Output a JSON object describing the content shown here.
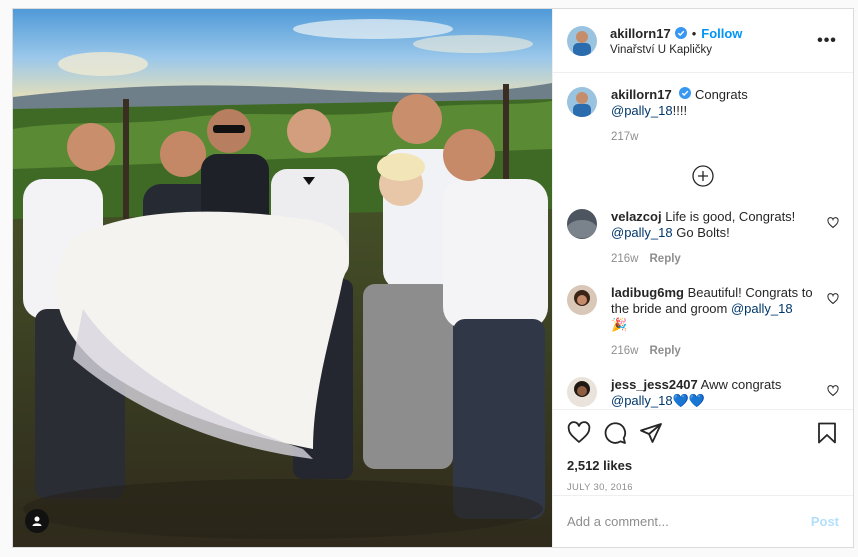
{
  "post": {
    "author": {
      "username": "akillorn17",
      "verified": true,
      "follow_label": "Follow",
      "location": "Vinařství U Kapličky",
      "more_label": "•••"
    },
    "caption": {
      "username": "akillorn17",
      "text": "Congrats ",
      "mention": "@pally_18",
      "suffix": "!!!!",
      "time": "217w"
    },
    "comments": [
      {
        "username": "velazcoj",
        "text": "Life is good, Congrats! ",
        "mention": "@pally_18",
        "suffix": " Go Bolts!",
        "time": "216w",
        "reply_label": "Reply"
      },
      {
        "username": "ladibug6mg",
        "text": "Beautiful! Congrats to the bride and groom ",
        "mention": "@pally_18",
        "suffix": "🎉",
        "time": "216w",
        "reply_label": "Reply"
      },
      {
        "username": "jess_jess2407",
        "text": "Aww congrats ",
        "mention": "@pally_18",
        "suffix": "💙💙",
        "time": "",
        "reply_label": ""
      }
    ],
    "likes": "2,512 likes",
    "date": "JULY 30, 2016",
    "add_comment_placeholder": "Add a comment...",
    "post_label": "Post",
    "icons": {
      "like": "heart-icon",
      "comment": "comment-icon",
      "share": "share-icon",
      "save": "bookmark-icon",
      "tag": "user-tag-icon",
      "load_more": "plus-circle-icon"
    },
    "colors": {
      "accent": "#0095f6",
      "mention": "#00376b",
      "muted": "#8e8e8e",
      "post_disabled": "#b2dffc"
    }
  }
}
